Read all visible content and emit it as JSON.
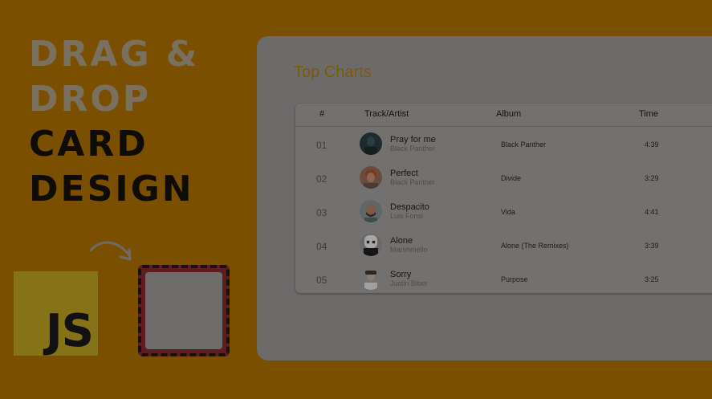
{
  "hero": {
    "line1": "DRAG &",
    "line2": "DROP",
    "line3": "CARD",
    "line4": "DESIGN"
  },
  "js_logo": {
    "text": "JS"
  },
  "charts": {
    "title": "Top Charts",
    "headers": {
      "num": "#",
      "track": "Track/Artist",
      "album": "Album",
      "time": "Time"
    },
    "rows": [
      {
        "num": "01",
        "track": "Pray for me",
        "artist": "Black Panther",
        "album": "Black Panther",
        "time": "4:39"
      },
      {
        "num": "02",
        "track": "Perfect",
        "artist": "Black Panther",
        "album": "Divide",
        "time": "3:29"
      },
      {
        "num": "03",
        "track": "Despacito",
        "artist": "Luis Fonsi",
        "album": "Vida",
        "time": "4:41"
      },
      {
        "num": "04",
        "track": "Alone",
        "artist": "Marshmello",
        "album": "Alone (The Remixes)",
        "time": "3:39"
      },
      {
        "num": "05",
        "track": "Sorry",
        "artist": "Justin Biber",
        "album": "Purpose",
        "time": "3:25"
      }
    ]
  },
  "colors": {
    "background": "#7a5000",
    "title_accent": "#7b5b0a",
    "dropzone_border": "#5e1d1f"
  }
}
